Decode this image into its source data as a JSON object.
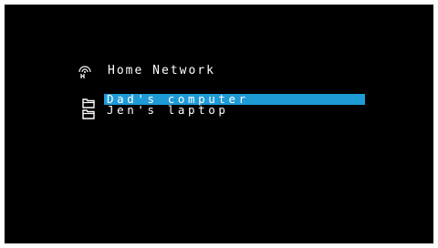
{
  "header": {
    "title": "Home Network",
    "icon": "network-share-icon"
  },
  "items": [
    {
      "label": "Dad's computer",
      "icon": "folder-icon",
      "selected": true
    },
    {
      "label": "Jen's laptop",
      "icon": "folder-icon",
      "selected": false
    }
  ],
  "colors": {
    "background": "#000000",
    "text": "#ffffff",
    "selection": "#1e9ad7"
  }
}
